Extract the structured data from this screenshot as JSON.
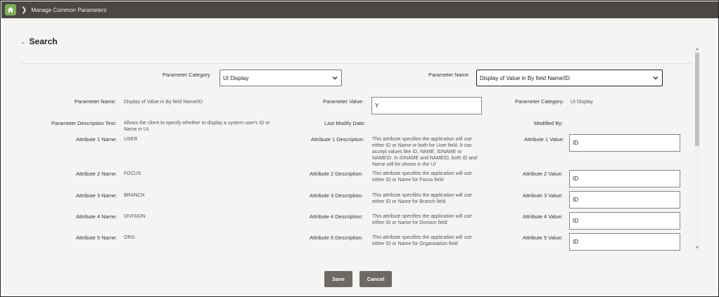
{
  "header": {
    "breadcrumb": "Manage Common Parameters",
    "icons": {
      "home": "home-icon",
      "separator": "chevron-right-icon"
    }
  },
  "section": {
    "title": "Search"
  },
  "search": {
    "parameter_category_label": "Parameter Category",
    "parameter_category_value": "UI Display",
    "parameter_name_label": "Parameter Name",
    "parameter_name_value": "Display of Value in By field Name/ID"
  },
  "details": {
    "param_name_label": "Parameter Name:",
    "param_name_value": "Display of Value in By field Name/ID",
    "param_value_label": "Parameter Value:",
    "param_value": "Y",
    "param_category_label": "Parameter Category:",
    "param_category_value": "UI Display",
    "desc_label": "Parameter Description Text:",
    "desc_value": "Allows the client to specify whether to display a system user's ID or Name in UI.",
    "last_modify_label": "Last Modify Date:",
    "modified_by_label": "Modified By:"
  },
  "attributes": [
    {
      "name_label": "Attribute 1 Name:",
      "name": "USER",
      "desc_label": "Attribute 1 Description:",
      "desc": "This attribute specifies the application will use either ID or Name or both for User field. It can accept values like ID, NAME, IDNAME or NAMEID. In IDNAME and NAMEID, both ID and Name will be shown in the UI",
      "value_label": "Attribute 1 Value:",
      "value": "ID"
    },
    {
      "name_label": "Attribute 2 Name:",
      "name": "FOCUS",
      "desc_label": "Attribute 2 Description:",
      "desc": "This attribute specifies the application will use either ID or Name for Focus field",
      "value_label": "Attribute 2 Value:",
      "value": "ID"
    },
    {
      "name_label": "Attribute 3 Name:",
      "name": "BRANCH",
      "desc_label": "Attribute 3 Description:",
      "desc": "This attribute specifies the application will use either ID or Name for Branch field",
      "value_label": "Attribute 3 Value:",
      "value": "ID"
    },
    {
      "name_label": "Attribute 4 Name:",
      "name": "DIVISION",
      "desc_label": "Attribute 4 Description:",
      "desc": "This attribute specifies the application will use either ID or Name for Division field",
      "value_label": "Attribute 4 Value:",
      "value": "ID"
    },
    {
      "name_label": "Attribute 5 Name:",
      "name": "ORG",
      "desc_label": "Attribute 5 Description:",
      "desc": "This attribute specifies the application will use either ID or Name for Organisation field",
      "value_label": "Attribute 5 Value:",
      "value": "ID"
    }
  ],
  "buttons": {
    "save": "Save",
    "cancel": "Cancel"
  },
  "colors": {
    "topbar": "#4b4743",
    "home": "#7fae5a",
    "button": "#6f6964",
    "panel": "#f5f4f2"
  }
}
